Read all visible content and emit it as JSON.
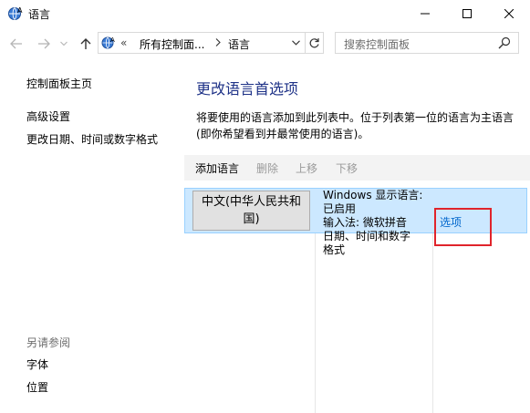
{
  "window": {
    "title": "语言"
  },
  "address_bar": {
    "overflow_chevron": "«",
    "segment_1": "所有控制面...",
    "segment_2": "语言"
  },
  "search": {
    "placeholder": "搜索控制面板"
  },
  "sidebar": {
    "home": "控制面板主页",
    "advanced": "高级设置",
    "date_time": "更改日期、时间或数字格式",
    "see_also": "另请参阅",
    "fonts": "字体",
    "location": "位置"
  },
  "main": {
    "title": "更改语言首选项",
    "description": "将要使用的语言添加到此列表中。位于列表第一位的语言为主语言(即你希望看到并最常使用的语言)。"
  },
  "toolbar": {
    "add": "添加语言",
    "remove": "删除",
    "move_up": "上移",
    "move_down": "下移"
  },
  "languages": [
    {
      "name": "中文(中华人民共和国)",
      "info_1": "Windows 显示语言:",
      "info_2": "已启用",
      "info_3": "输入法: 微软拼音",
      "info_4": "日期、时间和数字",
      "info_5": "格式",
      "options": "选项"
    }
  ],
  "colors": {
    "title_blue": "#1e3287",
    "link_blue": "#0066cc",
    "selection": "#cce8ff",
    "highlight_red": "#e0242b"
  }
}
